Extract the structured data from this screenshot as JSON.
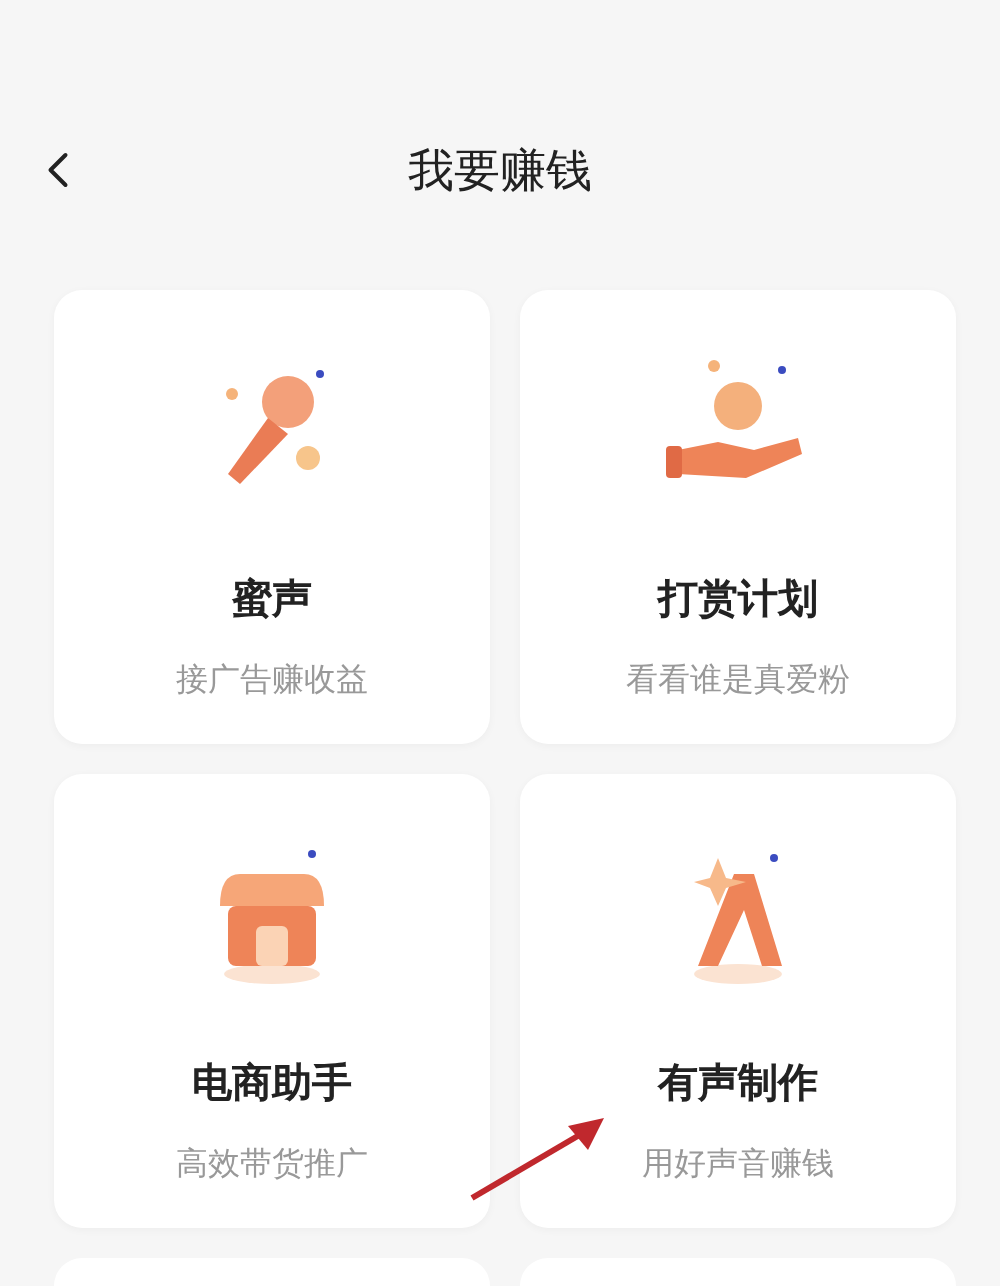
{
  "header": {
    "title": "我要赚钱"
  },
  "cards": [
    {
      "kind": "microphone",
      "title": "蜜声",
      "subtitle": "接广告赚收益"
    },
    {
      "kind": "coin-hand",
      "title": "打赏计划",
      "subtitle": "看看谁是真爱粉"
    },
    {
      "kind": "shop",
      "title": "电商助手",
      "subtitle": "高效带货推广"
    },
    {
      "kind": "star-peak",
      "title": "有声制作",
      "subtitle": "用好声音赚钱"
    }
  ]
}
